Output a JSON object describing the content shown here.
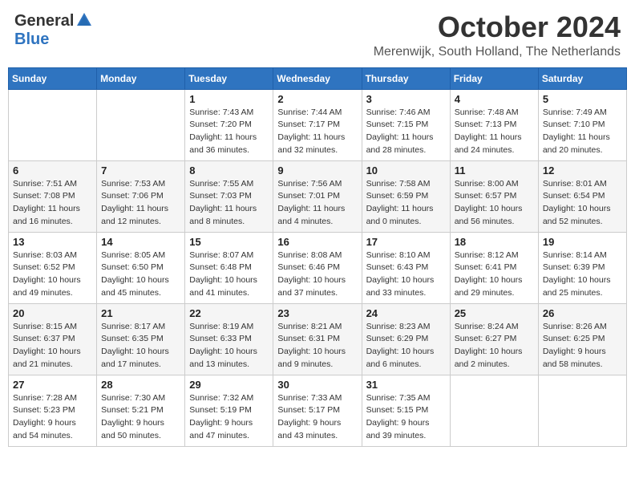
{
  "logo": {
    "general": "General",
    "blue": "Blue"
  },
  "header": {
    "month": "October 2024",
    "location": "Merenwijk, South Holland, The Netherlands"
  },
  "days_of_week": [
    "Sunday",
    "Monday",
    "Tuesday",
    "Wednesday",
    "Thursday",
    "Friday",
    "Saturday"
  ],
  "weeks": [
    [
      {
        "day": "",
        "sunrise": "",
        "sunset": "",
        "daylight": ""
      },
      {
        "day": "",
        "sunrise": "",
        "sunset": "",
        "daylight": ""
      },
      {
        "day": "1",
        "sunrise": "Sunrise: 7:43 AM",
        "sunset": "Sunset: 7:20 PM",
        "daylight": "Daylight: 11 hours and 36 minutes."
      },
      {
        "day": "2",
        "sunrise": "Sunrise: 7:44 AM",
        "sunset": "Sunset: 7:17 PM",
        "daylight": "Daylight: 11 hours and 32 minutes."
      },
      {
        "day": "3",
        "sunrise": "Sunrise: 7:46 AM",
        "sunset": "Sunset: 7:15 PM",
        "daylight": "Daylight: 11 hours and 28 minutes."
      },
      {
        "day": "4",
        "sunrise": "Sunrise: 7:48 AM",
        "sunset": "Sunset: 7:13 PM",
        "daylight": "Daylight: 11 hours and 24 minutes."
      },
      {
        "day": "5",
        "sunrise": "Sunrise: 7:49 AM",
        "sunset": "Sunset: 7:10 PM",
        "daylight": "Daylight: 11 hours and 20 minutes."
      }
    ],
    [
      {
        "day": "6",
        "sunrise": "Sunrise: 7:51 AM",
        "sunset": "Sunset: 7:08 PM",
        "daylight": "Daylight: 11 hours and 16 minutes."
      },
      {
        "day": "7",
        "sunrise": "Sunrise: 7:53 AM",
        "sunset": "Sunset: 7:06 PM",
        "daylight": "Daylight: 11 hours and 12 minutes."
      },
      {
        "day": "8",
        "sunrise": "Sunrise: 7:55 AM",
        "sunset": "Sunset: 7:03 PM",
        "daylight": "Daylight: 11 hours and 8 minutes."
      },
      {
        "day": "9",
        "sunrise": "Sunrise: 7:56 AM",
        "sunset": "Sunset: 7:01 PM",
        "daylight": "Daylight: 11 hours and 4 minutes."
      },
      {
        "day": "10",
        "sunrise": "Sunrise: 7:58 AM",
        "sunset": "Sunset: 6:59 PM",
        "daylight": "Daylight: 11 hours and 0 minutes."
      },
      {
        "day": "11",
        "sunrise": "Sunrise: 8:00 AM",
        "sunset": "Sunset: 6:57 PM",
        "daylight": "Daylight: 10 hours and 56 minutes."
      },
      {
        "day": "12",
        "sunrise": "Sunrise: 8:01 AM",
        "sunset": "Sunset: 6:54 PM",
        "daylight": "Daylight: 10 hours and 52 minutes."
      }
    ],
    [
      {
        "day": "13",
        "sunrise": "Sunrise: 8:03 AM",
        "sunset": "Sunset: 6:52 PM",
        "daylight": "Daylight: 10 hours and 49 minutes."
      },
      {
        "day": "14",
        "sunrise": "Sunrise: 8:05 AM",
        "sunset": "Sunset: 6:50 PM",
        "daylight": "Daylight: 10 hours and 45 minutes."
      },
      {
        "day": "15",
        "sunrise": "Sunrise: 8:07 AM",
        "sunset": "Sunset: 6:48 PM",
        "daylight": "Daylight: 10 hours and 41 minutes."
      },
      {
        "day": "16",
        "sunrise": "Sunrise: 8:08 AM",
        "sunset": "Sunset: 6:46 PM",
        "daylight": "Daylight: 10 hours and 37 minutes."
      },
      {
        "day": "17",
        "sunrise": "Sunrise: 8:10 AM",
        "sunset": "Sunset: 6:43 PM",
        "daylight": "Daylight: 10 hours and 33 minutes."
      },
      {
        "day": "18",
        "sunrise": "Sunrise: 8:12 AM",
        "sunset": "Sunset: 6:41 PM",
        "daylight": "Daylight: 10 hours and 29 minutes."
      },
      {
        "day": "19",
        "sunrise": "Sunrise: 8:14 AM",
        "sunset": "Sunset: 6:39 PM",
        "daylight": "Daylight: 10 hours and 25 minutes."
      }
    ],
    [
      {
        "day": "20",
        "sunrise": "Sunrise: 8:15 AM",
        "sunset": "Sunset: 6:37 PM",
        "daylight": "Daylight: 10 hours and 21 minutes."
      },
      {
        "day": "21",
        "sunrise": "Sunrise: 8:17 AM",
        "sunset": "Sunset: 6:35 PM",
        "daylight": "Daylight: 10 hours and 17 minutes."
      },
      {
        "day": "22",
        "sunrise": "Sunrise: 8:19 AM",
        "sunset": "Sunset: 6:33 PM",
        "daylight": "Daylight: 10 hours and 13 minutes."
      },
      {
        "day": "23",
        "sunrise": "Sunrise: 8:21 AM",
        "sunset": "Sunset: 6:31 PM",
        "daylight": "Daylight: 10 hours and 9 minutes."
      },
      {
        "day": "24",
        "sunrise": "Sunrise: 8:23 AM",
        "sunset": "Sunset: 6:29 PM",
        "daylight": "Daylight: 10 hours and 6 minutes."
      },
      {
        "day": "25",
        "sunrise": "Sunrise: 8:24 AM",
        "sunset": "Sunset: 6:27 PM",
        "daylight": "Daylight: 10 hours and 2 minutes."
      },
      {
        "day": "26",
        "sunrise": "Sunrise: 8:26 AM",
        "sunset": "Sunset: 6:25 PM",
        "daylight": "Daylight: 9 hours and 58 minutes."
      }
    ],
    [
      {
        "day": "27",
        "sunrise": "Sunrise: 7:28 AM",
        "sunset": "Sunset: 5:23 PM",
        "daylight": "Daylight: 9 hours and 54 minutes."
      },
      {
        "day": "28",
        "sunrise": "Sunrise: 7:30 AM",
        "sunset": "Sunset: 5:21 PM",
        "daylight": "Daylight: 9 hours and 50 minutes."
      },
      {
        "day": "29",
        "sunrise": "Sunrise: 7:32 AM",
        "sunset": "Sunset: 5:19 PM",
        "daylight": "Daylight: 9 hours and 47 minutes."
      },
      {
        "day": "30",
        "sunrise": "Sunrise: 7:33 AM",
        "sunset": "Sunset: 5:17 PM",
        "daylight": "Daylight: 9 hours and 43 minutes."
      },
      {
        "day": "31",
        "sunrise": "Sunrise: 7:35 AM",
        "sunset": "Sunset: 5:15 PM",
        "daylight": "Daylight: 9 hours and 39 minutes."
      },
      {
        "day": "",
        "sunrise": "",
        "sunset": "",
        "daylight": ""
      },
      {
        "day": "",
        "sunrise": "",
        "sunset": "",
        "daylight": ""
      }
    ]
  ]
}
